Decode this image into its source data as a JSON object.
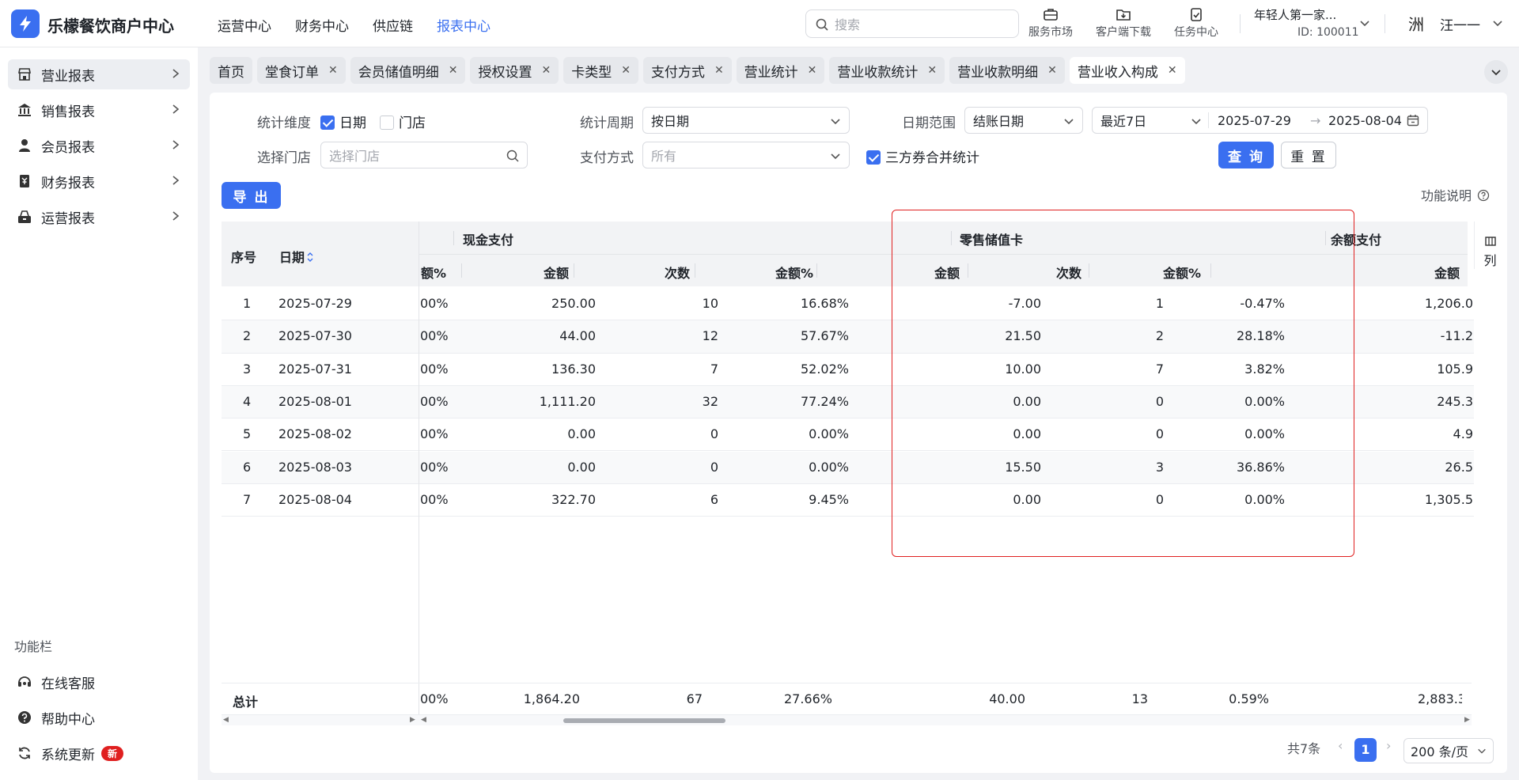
{
  "app": {
    "brand": "乐檬餐饮商户中心",
    "accent": "#3a6ff0",
    "highlight_color": "#e02020"
  },
  "topnav": [
    "运营中心",
    "财务中心",
    "供应链",
    "报表中心"
  ],
  "topnav_active": 3,
  "search": {
    "placeholder": "搜索"
  },
  "tools": [
    {
      "label": "服务市场",
      "icon": "briefcase-icon"
    },
    {
      "label": "客户端下载",
      "icon": "folder-download-icon"
    },
    {
      "label": "任务中心",
      "icon": "clipboard-check-icon"
    }
  ],
  "store": {
    "name": "年轻人第一家...",
    "id": "ID: 100011"
  },
  "user": {
    "avatar_text": "洲",
    "name": "汪一一"
  },
  "sidebar": {
    "items": [
      {
        "label": "营业报表",
        "icon": "store-icon"
      },
      {
        "label": "销售报表",
        "icon": "bank-icon"
      },
      {
        "label": "会员报表",
        "icon": "user-icon"
      },
      {
        "label": "财务报表",
        "icon": "ledger-icon"
      },
      {
        "label": "运营报表",
        "icon": "cash-register-icon"
      }
    ],
    "func_title": "功能栏",
    "func_items": [
      {
        "label": "在线客服",
        "icon": "headset-icon"
      },
      {
        "label": "帮助中心",
        "icon": "help-icon"
      },
      {
        "label": "系统更新",
        "icon": "refresh-icon",
        "badge": "新"
      }
    ]
  },
  "tabs": [
    "首页",
    "堂食订单",
    "会员储值明细",
    "授权设置",
    "卡类型",
    "支付方式",
    "营业统计",
    "营业收款统计",
    "营业收款明细",
    "营业收入构成"
  ],
  "active_tab": 9,
  "filters": {
    "dim_label": "统计维度",
    "dim_date": "日期",
    "dim_store": "门店",
    "period_label": "统计周期",
    "period_value": "按日期",
    "range_label": "日期范围",
    "range_type": "结账日期",
    "range_preset": "最近7日",
    "date_start": "2025-07-29",
    "date_end": "2025-08-04",
    "store_label": "选择门店",
    "store_placeholder": "选择门店",
    "pay_label": "支付方式",
    "pay_placeholder": "所有",
    "merge_label": "三方券合并统计",
    "query_btn": "查 询",
    "reset_btn": "重 置",
    "export_btn": "导 出",
    "help_link": "功能说明"
  },
  "table": {
    "h_index": "序号",
    "h_date": "日期",
    "groups": {
      "cash": "现金支付",
      "retail_card": "零售储值卡",
      "balance": "余额支付"
    },
    "sub": {
      "prev_pct": "额%",
      "amount": "金额",
      "count": "次数",
      "pct": "金额%",
      "amount_cut": "金额"
    },
    "columns_btn": "列",
    "rows": [
      {
        "idx": "1",
        "date": "2025-07-29",
        "prev": "00%",
        "cash_amt": "250.00",
        "cash_cnt": "10",
        "cash_pct": "16.68%",
        "card_amt": "-7.00",
        "card_cnt": "1",
        "card_pct": "-0.47%",
        "bal_amt": "1,206.0"
      },
      {
        "idx": "2",
        "date": "2025-07-30",
        "prev": "00%",
        "cash_amt": "44.00",
        "cash_cnt": "12",
        "cash_pct": "57.67%",
        "card_amt": "21.50",
        "card_cnt": "2",
        "card_pct": "28.18%",
        "bal_amt": "-11.2"
      },
      {
        "idx": "3",
        "date": "2025-07-31",
        "prev": "00%",
        "cash_amt": "136.30",
        "cash_cnt": "7",
        "cash_pct": "52.02%",
        "card_amt": "10.00",
        "card_cnt": "7",
        "card_pct": "3.82%",
        "bal_amt": "105.9"
      },
      {
        "idx": "4",
        "date": "2025-08-01",
        "prev": "00%",
        "cash_amt": "1,111.20",
        "cash_cnt": "32",
        "cash_pct": "77.24%",
        "card_amt": "0.00",
        "card_cnt": "0",
        "card_pct": "0.00%",
        "bal_amt": "245.3"
      },
      {
        "idx": "5",
        "date": "2025-08-02",
        "prev": "00%",
        "cash_amt": "0.00",
        "cash_cnt": "0",
        "cash_pct": "0.00%",
        "card_amt": "0.00",
        "card_cnt": "0",
        "card_pct": "0.00%",
        "bal_amt": "4.9"
      },
      {
        "idx": "6",
        "date": "2025-08-03",
        "prev": "00%",
        "cash_amt": "0.00",
        "cash_cnt": "0",
        "cash_pct": "0.00%",
        "card_amt": "15.50",
        "card_cnt": "3",
        "card_pct": "36.86%",
        "bal_amt": "26.5"
      },
      {
        "idx": "7",
        "date": "2025-08-04",
        "prev": "00%",
        "cash_amt": "322.70",
        "cash_cnt": "6",
        "cash_pct": "9.45%",
        "card_amt": "0.00",
        "card_cnt": "0",
        "card_pct": "0.00%",
        "bal_amt": "1,305.5"
      }
    ],
    "total": {
      "label": "总计",
      "prev": "00%",
      "cash_amt": "1,864.20",
      "cash_cnt": "67",
      "cash_pct": "27.66%",
      "card_amt": "40.00",
      "card_cnt": "13",
      "card_pct": "0.59%",
      "bal_amt": "2,883.3"
    }
  },
  "pager": {
    "total": "共7条",
    "page": "1",
    "size": "200 条/页"
  }
}
